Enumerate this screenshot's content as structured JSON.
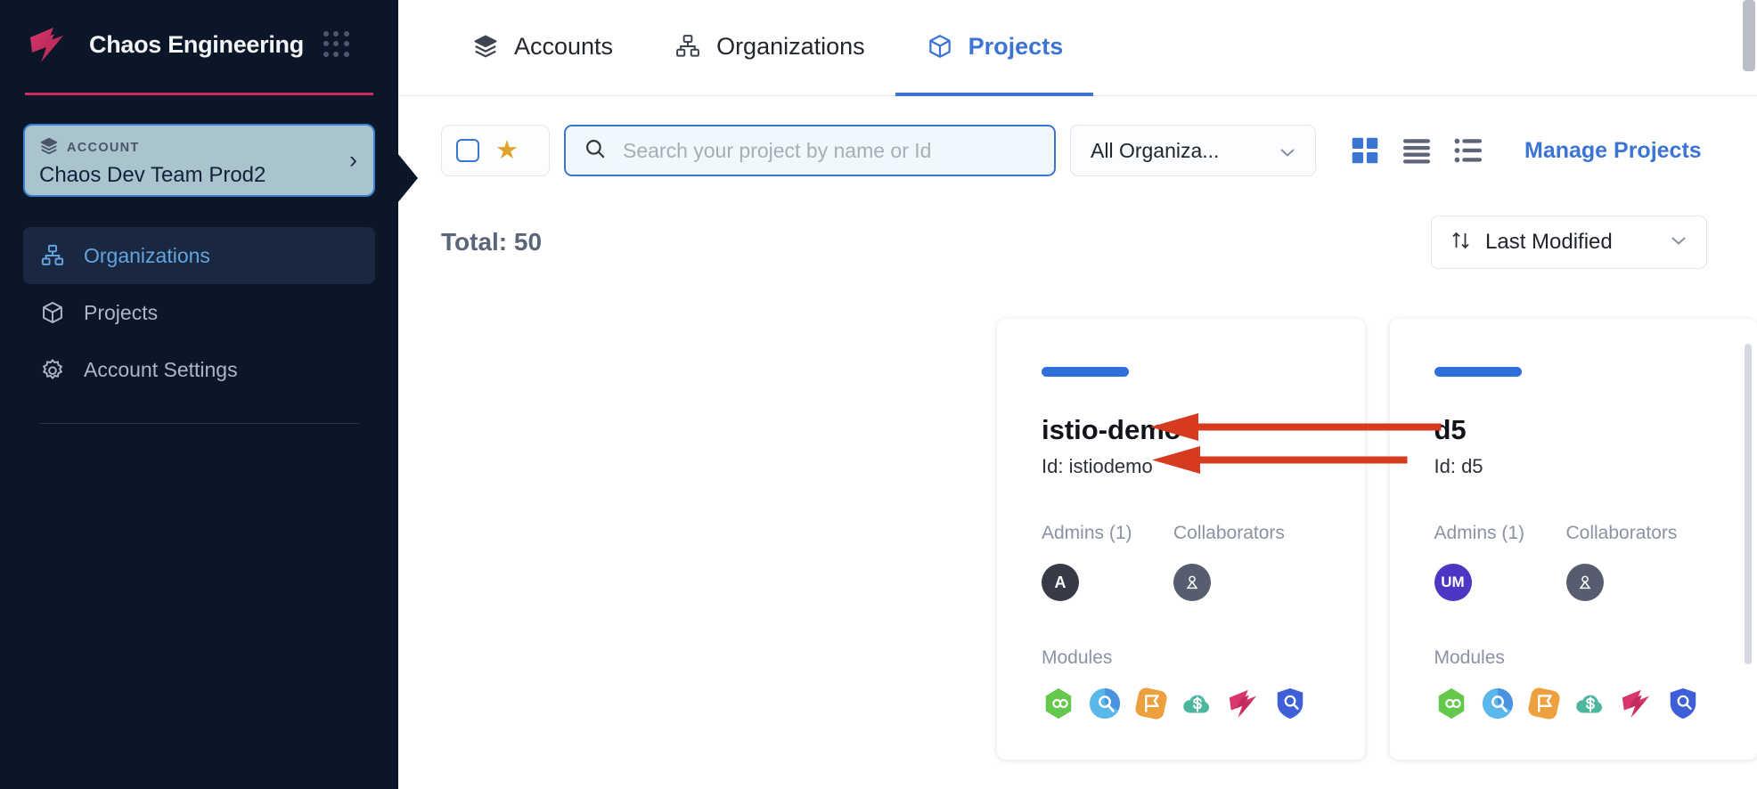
{
  "sidebar": {
    "brand": {
      "title": "Chaos Engineering",
      "logo_icon": "harness-chaos-logo",
      "apps_icon": "grid-dots-icon"
    },
    "account": {
      "label": "ACCOUNT",
      "label_icon": "layers-icon",
      "name": "Chaos Dev Team Prod2",
      "chevron_icon": "chevron-right-icon"
    },
    "items": [
      {
        "label": "Organizations",
        "icon": "org-hierarchy-icon",
        "active": true
      },
      {
        "label": "Projects",
        "icon": "cube-icon",
        "active": false
      },
      {
        "label": "Account Settings",
        "icon": "gear-icon",
        "active": false
      }
    ]
  },
  "tabs": [
    {
      "label": "Accounts",
      "icon": "layers-icon",
      "active": false
    },
    {
      "label": "Organizations",
      "icon": "org-hierarchy-icon",
      "active": false
    },
    {
      "label": "Projects",
      "icon": "cube-icon",
      "active": true
    }
  ],
  "toolbar": {
    "favorites_icon": "star-icon",
    "favorites_checkbox_icon": "checkbox-icon",
    "search": {
      "placeholder": "Search your project by name or Id",
      "value": "",
      "icon": "search-icon"
    },
    "org_filter": {
      "value": "All Organiza...",
      "icon": "chevron-down-icon"
    },
    "views": [
      {
        "name": "grid-view",
        "icon": "grid-view-icon",
        "active": true
      },
      {
        "name": "list-view",
        "icon": "list-view-icon",
        "active": false
      },
      {
        "name": "detail-view",
        "icon": "detail-list-view-icon",
        "active": false
      }
    ],
    "manage_projects": "Manage Projects"
  },
  "results": {
    "total": "Total: 50",
    "sort": {
      "value": "Last Modified",
      "icon": "sort-arrows-icon",
      "chevron": "chevron-down-icon"
    }
  },
  "projects": [
    {
      "name": "istio-demo",
      "id": "Id: istiodemo",
      "accent": "#2f6fd9",
      "admins_label": "Admins (1)",
      "collaborators_label": "Collaborators",
      "admin_avatar": "A",
      "admin_avatar_style": "dark",
      "collaborator_avatar_icon": "user-icon",
      "modules_label": "Modules",
      "modules": [
        "cicd-module-icon",
        "srm-module-icon",
        "feature-flags-module-icon",
        "cloud-costs-module-icon",
        "chaos-module-icon",
        "security-tests-module-icon"
      ]
    },
    {
      "name": "d5",
      "id": "Id: d5",
      "accent": "#2f6fd9",
      "admins_label": "Admins (1)",
      "collaborators_label": "Collaborators",
      "admin_avatar": "UM",
      "admin_avatar_style": "purple",
      "collaborator_avatar_icon": "user-icon",
      "modules_label": "Modules",
      "modules": [
        "cicd-module-icon",
        "srm-module-icon",
        "feature-flags-module-icon",
        "cloud-costs-module-icon",
        "chaos-module-icon",
        "security-tests-module-icon"
      ]
    }
  ],
  "annotations": {
    "color": "#d63b1f",
    "arrows": [
      {
        "target": "project-name",
        "name": "annotation-arrow-project-name"
      },
      {
        "target": "project-id",
        "name": "annotation-arrow-project-id"
      }
    ]
  },
  "colors": {
    "sidebar_bg": "#0b1628",
    "brand_accent": "#cf2b5b",
    "primary": "#3c74d4",
    "account_card_bg": "#a9c4cd",
    "star": "#e0a32e"
  }
}
